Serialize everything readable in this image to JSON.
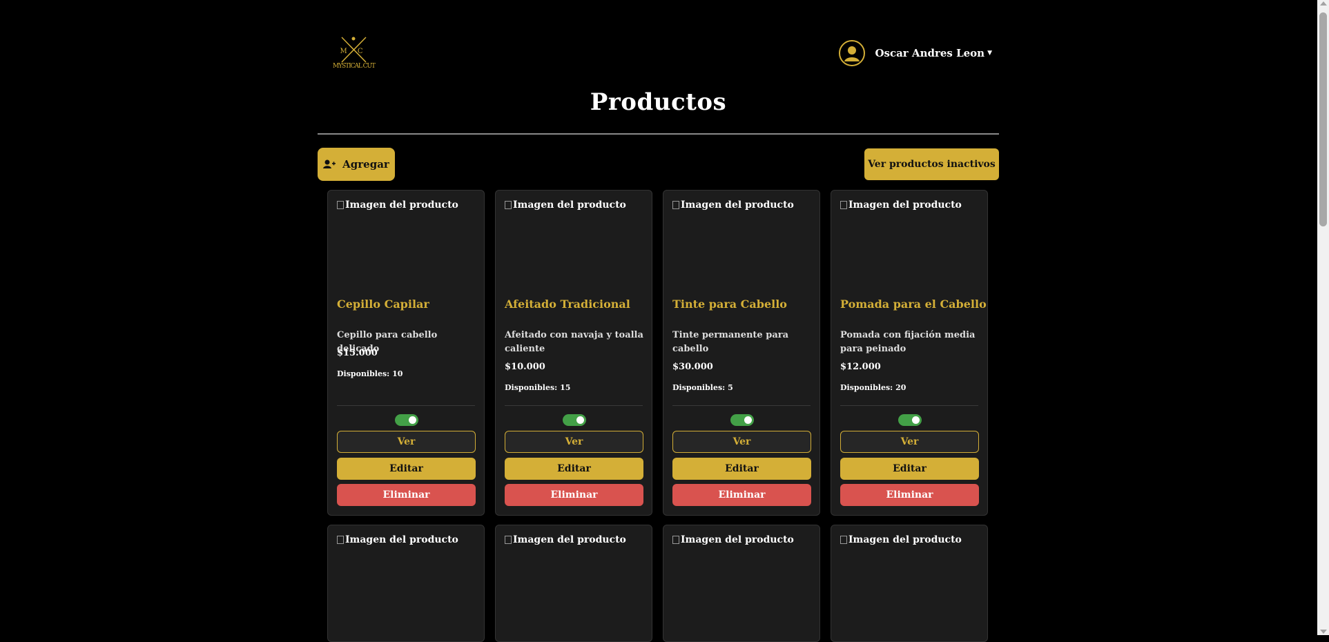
{
  "header": {
    "logo_text": "MYSTICAL CUT",
    "logo_monogram": "M C",
    "user_name": "Oscar Andres Leon"
  },
  "page_title": "Productos",
  "actions": {
    "add_label": "Agregar",
    "inactive_label": "Ver productos inactivos"
  },
  "card_labels": {
    "image_alt": "Imagen del producto",
    "stock_prefix": "Disponibles:",
    "view": "Ver",
    "edit": "Editar",
    "delete": "Eliminar"
  },
  "products": [
    {
      "name": "Cepillo Capilar",
      "description": "Cepillo para cabello delicado",
      "price": "$15.000",
      "stock": "10",
      "active": true
    },
    {
      "name": "Afeitado Tradicional",
      "description": "Afeitado con navaja y toalla caliente",
      "price": "$10.000",
      "stock": "15",
      "active": true
    },
    {
      "name": "Tinte para Cabello",
      "description": "Tinte permanente para cabello",
      "price": "$30.000",
      "stock": "5",
      "active": true
    },
    {
      "name": "Pomada para el Cabello",
      "description": "Pomada con fijación media para peinado",
      "price": "$12.000",
      "stock": "20",
      "active": true
    }
  ],
  "colors": {
    "accent": "#d4af37",
    "danger": "#d9534f",
    "toggle_on": "#43a047",
    "card_bg": "#1c1c1c"
  },
  "icons": [
    "logo-icon",
    "user-avatar-icon",
    "caret-down-icon",
    "add-user-icon",
    "broken-image-icon"
  ]
}
